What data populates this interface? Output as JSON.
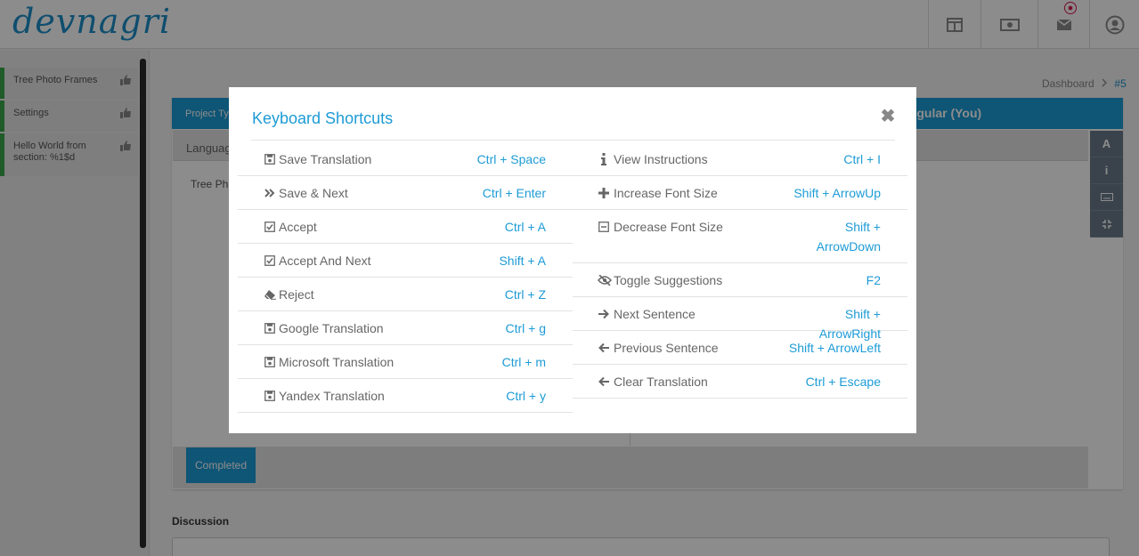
{
  "header": {
    "logo_text": "devnagri",
    "icons": [
      "layout-icon",
      "money-icon",
      "mail-icon",
      "user-icon"
    ]
  },
  "sidebar": {
    "items": [
      {
        "label": "Tree Photo Frames"
      },
      {
        "label": "Settings"
      },
      {
        "label": "Hello World from section: %1$d"
      }
    ]
  },
  "breadcrumb": {
    "home": "Dashboard",
    "separator": ">",
    "current": "#5"
  },
  "panel": {
    "project_type_label": "Project Ty",
    "language_label": "Languag",
    "target_language": "angular (You)",
    "source_text": "Tree Ph",
    "tools": [
      "A",
      "i",
      "keyboard-icon",
      "compress-icon"
    ],
    "completed_button": "Completed"
  },
  "discussion": {
    "label": "Discussion"
  },
  "modal": {
    "title": "Keyboard Shortcuts",
    "close_symbol": "✖",
    "left_shortcuts": [
      {
        "icon": "save-icon",
        "label": "Save Translation",
        "key": "Ctrl + Space"
      },
      {
        "icon": "double-chevron-right-icon",
        "label": "Save & Next",
        "key": "Ctrl + Enter"
      },
      {
        "icon": "check-square-icon",
        "label": "Accept",
        "key": "Ctrl + A"
      },
      {
        "icon": "check-square-icon",
        "label": "Accept And Next",
        "key": "Shift + A"
      },
      {
        "icon": "eraser-icon",
        "label": "Reject",
        "key": "Ctrl + Z"
      },
      {
        "icon": "save-icon",
        "label": "Google Translation",
        "key": "Ctrl + g"
      },
      {
        "icon": "save-icon",
        "label": "Microsoft Translation",
        "key": "Ctrl + m"
      },
      {
        "icon": "save-icon",
        "label": "Yandex Translation",
        "key": "Ctrl + y"
      }
    ],
    "right_shortcuts": [
      {
        "icon": "info-icon",
        "label": "View Instructions",
        "key": "Ctrl + I"
      },
      {
        "icon": "plus-icon",
        "label": "Increase Font Size",
        "key": "Shift + ArrowUp"
      },
      {
        "icon": "minus-square-icon",
        "label": "Decrease Font Size",
        "key": "Shift + ArrowDown"
      },
      {
        "icon": "eye-slash-icon",
        "label": "Toggle Suggestions",
        "key": "F2"
      },
      {
        "icon": "arrow-right-icon",
        "label": "Next Sentence",
        "key": "Shift + ArrowRight"
      },
      {
        "icon": "arrow-left-icon",
        "label": "Previous Sentence",
        "key": "Shift + ArrowLeft"
      },
      {
        "icon": "arrow-left-icon",
        "label": "Clear Translation",
        "key": "Ctrl + Escape"
      }
    ]
  },
  "colors": {
    "accent": "#1d9bd6",
    "sidebar_active": "#3aa64a",
    "tool_rail": "#6b7b89"
  }
}
